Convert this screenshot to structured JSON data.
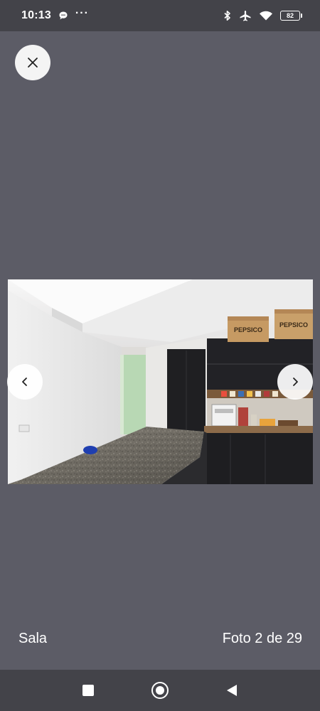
{
  "status_bar": {
    "time": "10:13",
    "overflow_dots": "···",
    "battery_level": "82",
    "icons": [
      "chat-bubble-icon",
      "bluetooth-icon",
      "airplane-mode-icon",
      "wifi-icon",
      "battery-icon"
    ]
  },
  "viewer": {
    "close_icon": "close-icon",
    "prev_icon": "chevron-left-icon",
    "next_icon": "chevron-right-icon",
    "photo_box_labels": [
      "PEPSICO",
      "PEPSICO"
    ]
  },
  "caption": {
    "room": "Sala",
    "counter": "Foto 2 de 29"
  },
  "android_nav": {
    "icons": [
      "recents-icon",
      "home-icon",
      "back-icon"
    ]
  },
  "colors": {
    "background": "#5c5c66",
    "status_bar": "#434349",
    "button_bg": "#f4f4f4",
    "text": "#ffffff"
  }
}
